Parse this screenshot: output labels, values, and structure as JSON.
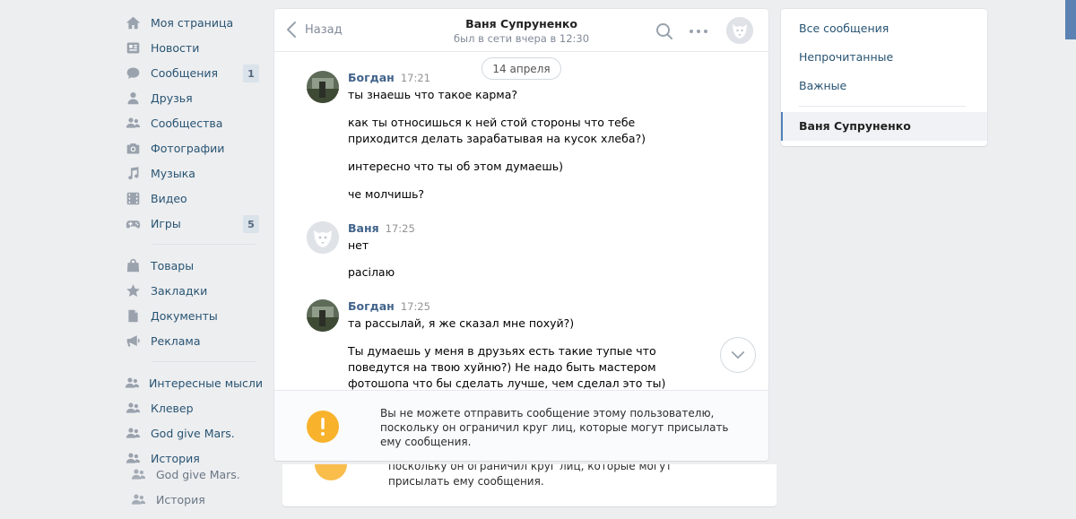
{
  "leftnav": {
    "items": [
      {
        "label": "Моя страница",
        "icon": "home-icon"
      },
      {
        "label": "Новости",
        "icon": "news-icon"
      },
      {
        "label": "Сообщения",
        "icon": "messages-icon",
        "badge": "1"
      },
      {
        "label": "Друзья",
        "icon": "friend-icon"
      },
      {
        "label": "Сообщества",
        "icon": "groups-icon"
      },
      {
        "label": "Фотографии",
        "icon": "camera-icon"
      },
      {
        "label": "Музыка",
        "icon": "music-icon"
      },
      {
        "label": "Видео",
        "icon": "video-icon"
      },
      {
        "label": "Игры",
        "icon": "gamepad-icon",
        "badge": "5"
      }
    ],
    "items2": [
      {
        "label": "Товары",
        "icon": "bag-icon"
      },
      {
        "label": "Закладки",
        "icon": "star-icon"
      },
      {
        "label": "Документы",
        "icon": "document-icon"
      },
      {
        "label": "Реклама",
        "icon": "megaphone-icon"
      }
    ],
    "groups": [
      {
        "label": "Интересные мысли",
        "icon": "groups-icon"
      },
      {
        "label": "Клевер",
        "icon": "groups-icon"
      },
      {
        "label": "God give Mars.",
        "icon": "groups-icon"
      },
      {
        "label": "История",
        "icon": "groups-icon"
      }
    ],
    "ghost_items": [
      "God give Mars.",
      "История"
    ]
  },
  "chat": {
    "back_label": "Назад",
    "peer_name": "Ваня Супруненко",
    "peer_status": "был в сети вчера в 12:30",
    "date": "14 апреля",
    "groups": [
      {
        "author": "Богдан",
        "time": "17:21",
        "messages": [
          "ты знаешь что такое карма?",
          "как ты относишься к ней стой стороны что тебе приходится делать зарабатывая на кусок хлеба?)",
          "интересно что ты об этом думаешь)",
          "че молчишь?"
        ]
      },
      {
        "author": "Ваня",
        "time": "17:25",
        "messages": [
          "нет",
          "расiлаю"
        ]
      },
      {
        "author": "Богдан",
        "time": "17:25",
        "messages": [
          "та рассылай, я же сказал мне похуй?)",
          "Ты думаешь у меня в друзьях есть такие тупые что поведутся на твою хуйню?) Не надо быть мастером фотошопа что бы сделать лучше, чем сделал это ты)"
        ]
      }
    ],
    "blocked_notice": "Вы не можете отправить сообщение этому пользователю, поскольку он ограничил круг лиц, которые могут присылать ему сообщения.",
    "ghost_notice": "поскольку он ограничил круг лиц, которые могут присылать ему сообщения."
  },
  "filters": {
    "items": [
      "Все сообщения",
      "Непрочитанные",
      "Важные"
    ],
    "active": "Ваня Супруненко"
  },
  "colors": {
    "accent": "#5181b8",
    "link": "#285473",
    "author": "#42648b",
    "warning": "#f8b22b",
    "background": "#edeef0"
  }
}
